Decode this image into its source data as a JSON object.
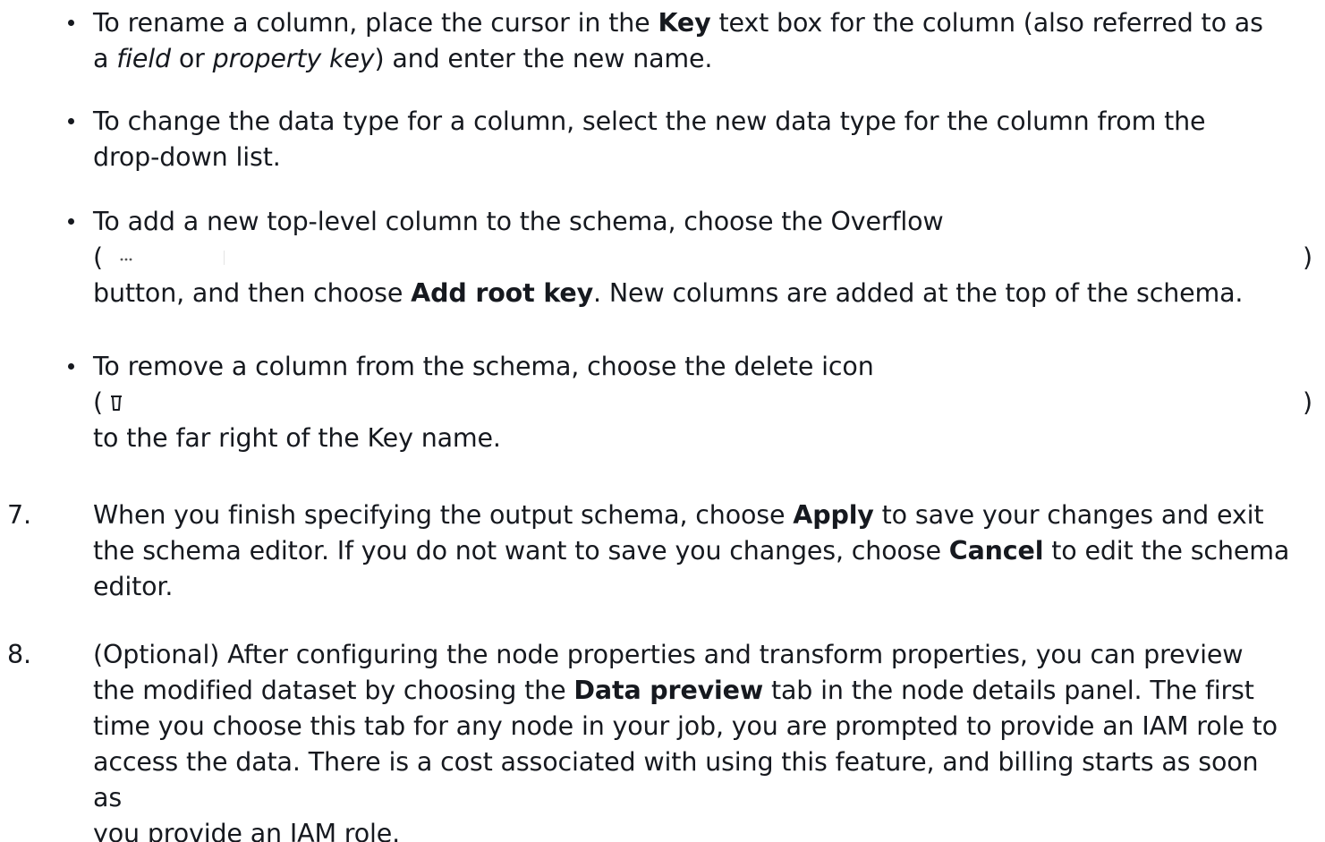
{
  "bullets": [
    {
      "line1_pre": "To rename a column, place the cursor in the ",
      "line1_bold": "Key",
      "line1_post": " text box for the column (also referred to as",
      "line2_pre": "a ",
      "line2_em1": "field",
      "line2_mid": " or ",
      "line2_em2": "property key",
      "line2_post": ") and enter the new name."
    },
    {
      "line1": "To change the data type for a column, select the new data type for the column from the",
      "line2": "drop-down list."
    },
    {
      "line1": "To add a new top-level column to the schema, choose the Overflow",
      "paren_open": "(",
      "paren_close": ")",
      "icon": "ellipsis-icon",
      "line3_pre": "button, and then choose ",
      "line3_bold": "Add root key",
      "line3_post": ". New columns are added at the top of the schema."
    },
    {
      "line1": "To remove a column from the schema, choose the delete icon",
      "paren_open": "(",
      "paren_close": ")",
      "icon": "trash-icon",
      "line3": "to the far right of the Key name."
    }
  ],
  "steps": [
    {
      "number": "7.",
      "line1_pre": "When you finish specifying the output schema, choose ",
      "line1_bold": "Apply",
      "line1_post": " to save your changes and exit",
      "line2_pre": "the schema editor. If you do not want to save you changes, choose ",
      "line2_bold": "Cancel",
      "line2_post": " to edit the schema",
      "line3": "editor."
    },
    {
      "number": "8.",
      "line1": "(Optional) After configuring the node properties and transform properties, you can preview",
      "line2_pre": "the modified dataset by choosing the ",
      "line2_bold": "Data preview",
      "line2_post": " tab in the node details panel. The first",
      "line3": "time you choose this tab for any node in your job, you are prompted to provide an IAM role to",
      "line4": "access the data. There is a cost associated with using this feature, and billing starts as soon as",
      "line5": "you provide an IAM role."
    }
  ]
}
